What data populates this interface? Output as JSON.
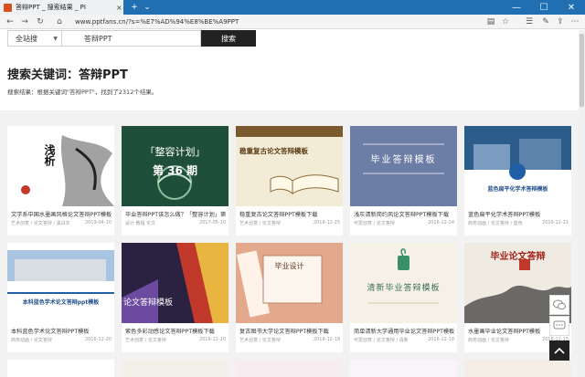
{
  "browser": {
    "tab_title": "答辩PPT _ 搜索结果 _ PI",
    "tab_close": "×",
    "url": "www.pptfans.cn/?s=%E7%AD%94%E8%BE%A9PPT",
    "minimize": "—",
    "maximize": "☐",
    "close": "✕"
  },
  "search": {
    "scope": "全站搜",
    "query": "答辩PPT",
    "button": "搜索"
  },
  "results": {
    "heading": "搜索关键词：答辩PPT",
    "summary": "搜索结果：根据关键词\"答辩PPT\"，找到了2312个结果。"
  },
  "cards": [
    {
      "title": "文学系中国水墨画风格论文答辩PPT模板",
      "meta": "艺术创意 / 论文答辩 / 黑白灰",
      "date": "2019-04-10",
      "thumb_text": "浅析",
      "bg": "#ffffff"
    },
    {
      "title": "毕业答辩PPT该怎么做？「整容计划」第",
      "meta": "设计 教程 论文",
      "date": "2017-05-10",
      "thumb_text": "「整容计划」",
      "thumb_text2": "第 36 期",
      "bg": "#1f4f3a"
    },
    {
      "title": "稳重复古论文答辩PPT模板下载",
      "meta": "艺术创意 / 论文答辩",
      "date": "2016-12-25",
      "thumb_text": "稳重复古论文答辩模板",
      "bg": "#f2ecd6"
    },
    {
      "title": "浅灰清新简约风论文答辩PPT模板下载",
      "meta": "可爱创意 / 论文答辩",
      "date": "2016-12-24",
      "thumb_text": "毕业答辩模板",
      "bg": "#6d7ea6"
    },
    {
      "title": "蓝色扁平化学术答辩PPT模板",
      "meta": "商务动画 / 论文答辩 / 蓝色",
      "date": "2016-12-21",
      "thumb_text": "蓝色扁平化学术答辩模板",
      "bg": "#ffffff"
    },
    {
      "title": "本科蓝色学术论文答辩PPT模板",
      "meta": "商务动画 / 论文答辩",
      "date": "2016-12-20",
      "thumb_text": "本科蓝色学术论文答辩ppt模板",
      "bg": "#ffffff"
    },
    {
      "title": "紫色多彩动感论文答辩PPT模板下载",
      "meta": "艺术创意 / 论文答辩",
      "date": "2016-12-20",
      "thumb_text": "论文答辩模板",
      "bg": "#2a2240"
    },
    {
      "title": "复古图书大学论文答辩PPT模板下载",
      "meta": "艺术创意 / 论文答辩",
      "date": "2016-12-18",
      "thumb_text": "毕业设计",
      "bg": "#e3a98c"
    },
    {
      "title": "简单清新大学通用毕业论文答辩PPT模板",
      "meta": "可爱创意 / 论文答辩 / 清新",
      "date": "2016-12-18",
      "thumb_text": "清新毕业答辩模板",
      "bg": "#f5f1e6"
    },
    {
      "title": "水墨画毕业论文答辩PPT模板",
      "meta": "商务动画 / 论文答辩",
      "date": "2016-12-15",
      "thumb_text": "毕业论文答辩",
      "bg": "#efeae2"
    }
  ],
  "colors": {
    "titlebar": "#1f6fb2",
    "search_button": "#222222",
    "band": "#f2f2f2"
  },
  "floating": {
    "wechat_icon": "wechat-icon",
    "chat_icon": "chat-icon",
    "top_icon": "back-to-top-icon"
  }
}
